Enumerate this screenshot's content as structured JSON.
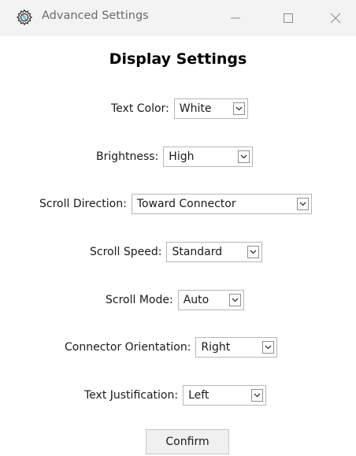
{
  "window": {
    "title": "Advanced Settings",
    "icon": "gear-icon",
    "controls": [
      "minimize-icon",
      "maximize-icon",
      "close-icon"
    ]
  },
  "heading": "Display Settings",
  "settings": {
    "text_color": {
      "label": "Text Color:",
      "value": "White"
    },
    "brightness": {
      "label": "Brightness:",
      "value": "High"
    },
    "scroll_direction": {
      "label": "Scroll Direction:",
      "value": "Toward Connector"
    },
    "scroll_speed": {
      "label": "Scroll Speed:",
      "value": "Standard"
    },
    "scroll_mode": {
      "label": "Scroll Mode:",
      "value": "Auto"
    },
    "connector_orientation": {
      "label": "Connector Orientation:",
      "value": "Right"
    },
    "text_justification": {
      "label": "Text Justification:",
      "value": "Left"
    }
  },
  "confirm_label": "Confirm",
  "colors": {
    "titlebar_bg": "#f3f3f3",
    "title_text": "#6b6b6b",
    "border": "#b7b7b7",
    "button_bg": "#f0f0f0"
  }
}
